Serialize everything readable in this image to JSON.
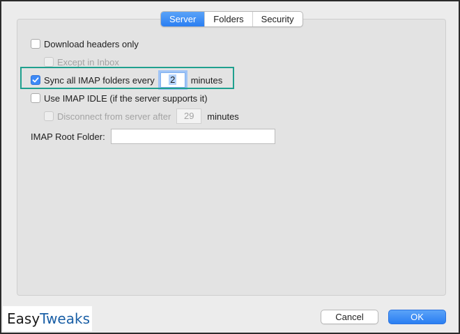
{
  "tabs": [
    {
      "label": "Server",
      "active": true
    },
    {
      "label": "Folders",
      "active": false
    },
    {
      "label": "Security",
      "active": false
    }
  ],
  "options": {
    "download_headers": {
      "label": "Download headers only",
      "checked": false
    },
    "except_inbox": {
      "label": "Except in Inbox",
      "checked": false,
      "disabled": true
    },
    "sync_folders": {
      "label": "Sync all IMAP folders every",
      "checked": true,
      "value": "2",
      "suffix": "minutes"
    },
    "imap_idle": {
      "label": "Use IMAP IDLE (if the server supports it)",
      "checked": false
    },
    "disconnect": {
      "label": "Disconnect from server after",
      "checked": false,
      "disabled": true,
      "value": "29",
      "suffix": "minutes"
    }
  },
  "root_folder": {
    "label": "IMAP Root Folder:",
    "value": ""
  },
  "buttons": {
    "cancel": "Cancel",
    "ok": "OK"
  },
  "logo": {
    "part1": "Easy",
    "part2": "Tweaks"
  },
  "colors": {
    "accent": "#2a7ef2",
    "highlight": "#1fa08e",
    "logo_blue": "#1a5fa6"
  },
  "icons": {
    "checkbox_check": "checkmark-icon"
  }
}
